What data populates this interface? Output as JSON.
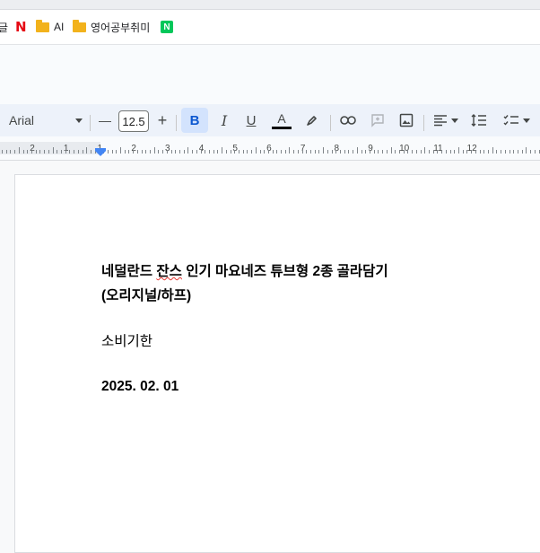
{
  "bookmarks": {
    "partial_label": "글",
    "items": [
      {
        "icon": "netflix-icon",
        "label": ""
      },
      {
        "icon": "folder-icon",
        "label": "AI"
      },
      {
        "icon": "folder-icon",
        "label": "영어공부취미"
      },
      {
        "icon": "naver-icon",
        "label": ""
      }
    ],
    "netflix_glyph": "N",
    "naver_glyph": "N"
  },
  "toolbar": {
    "font_name": "Arial",
    "minus": "—",
    "font_size": "12.5",
    "plus": "+",
    "bold": "B",
    "italic": "I",
    "underline": "U",
    "text_color": "A",
    "text_color_value": "#000000"
  },
  "ruler": {
    "labels": [
      "2",
      "1",
      "1",
      "2",
      "3",
      "4",
      "5",
      "6",
      "7",
      "8",
      "9",
      "10",
      "11",
      "12"
    ]
  },
  "document": {
    "title_line1_prefix": "네덜란드 ",
    "title_line1_misspelled": "잔스",
    "title_line1_rest": " 인기 마요네즈 튜브형 2종 골라담기",
    "title_line2": "(오리지널/하프)",
    "expiry_label": "소비기한",
    "expiry_date": "2025. 02. 01"
  }
}
